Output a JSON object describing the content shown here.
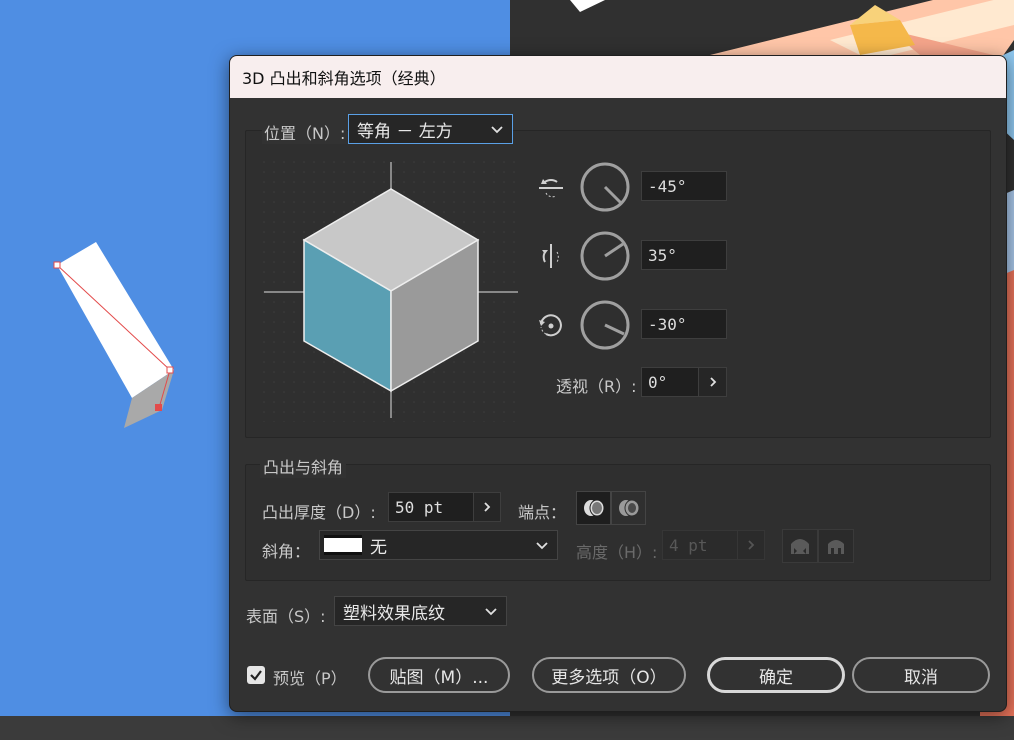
{
  "dialog": {
    "title": "3D 凸出和斜角选项（经典）",
    "position": {
      "label": "位置（N）:",
      "selected": "等角 － 左方",
      "rotations": [
        {
          "icon": "rotate-x-axis-icon",
          "value": "-45°"
        },
        {
          "icon": "rotate-y-axis-icon",
          "value": "35°"
        },
        {
          "icon": "rotate-z-axis-icon",
          "value": "-30°"
        }
      ],
      "perspective_label": "透视（R）:",
      "perspective_value": "0°"
    },
    "extrude": {
      "section_title": "凸出与斜角",
      "depth_label": "凸出厚度（D）:",
      "depth_value": "50 pt",
      "cap_label": "端点：",
      "bevel_label": "斜角：",
      "bevel_value": "无",
      "height_label": "高度（H）:",
      "height_value": "4 pt"
    },
    "surface": {
      "label": "表面（S）:",
      "selected": "塑料效果底纹"
    },
    "preview": {
      "label": "预览（P）",
      "checked": true
    },
    "buttons": {
      "map": "贴图（M）...",
      "more": "更多选项（O）",
      "ok": "确定",
      "cancel": "取消"
    }
  },
  "colors": {
    "canvas_blue": "#4f8ee3",
    "cube_left_face": "#5a9fb3",
    "cube_top_face": "#c8c8c8",
    "cube_right_face": "#9a9a9a",
    "titlebar": "#f8eeee"
  }
}
